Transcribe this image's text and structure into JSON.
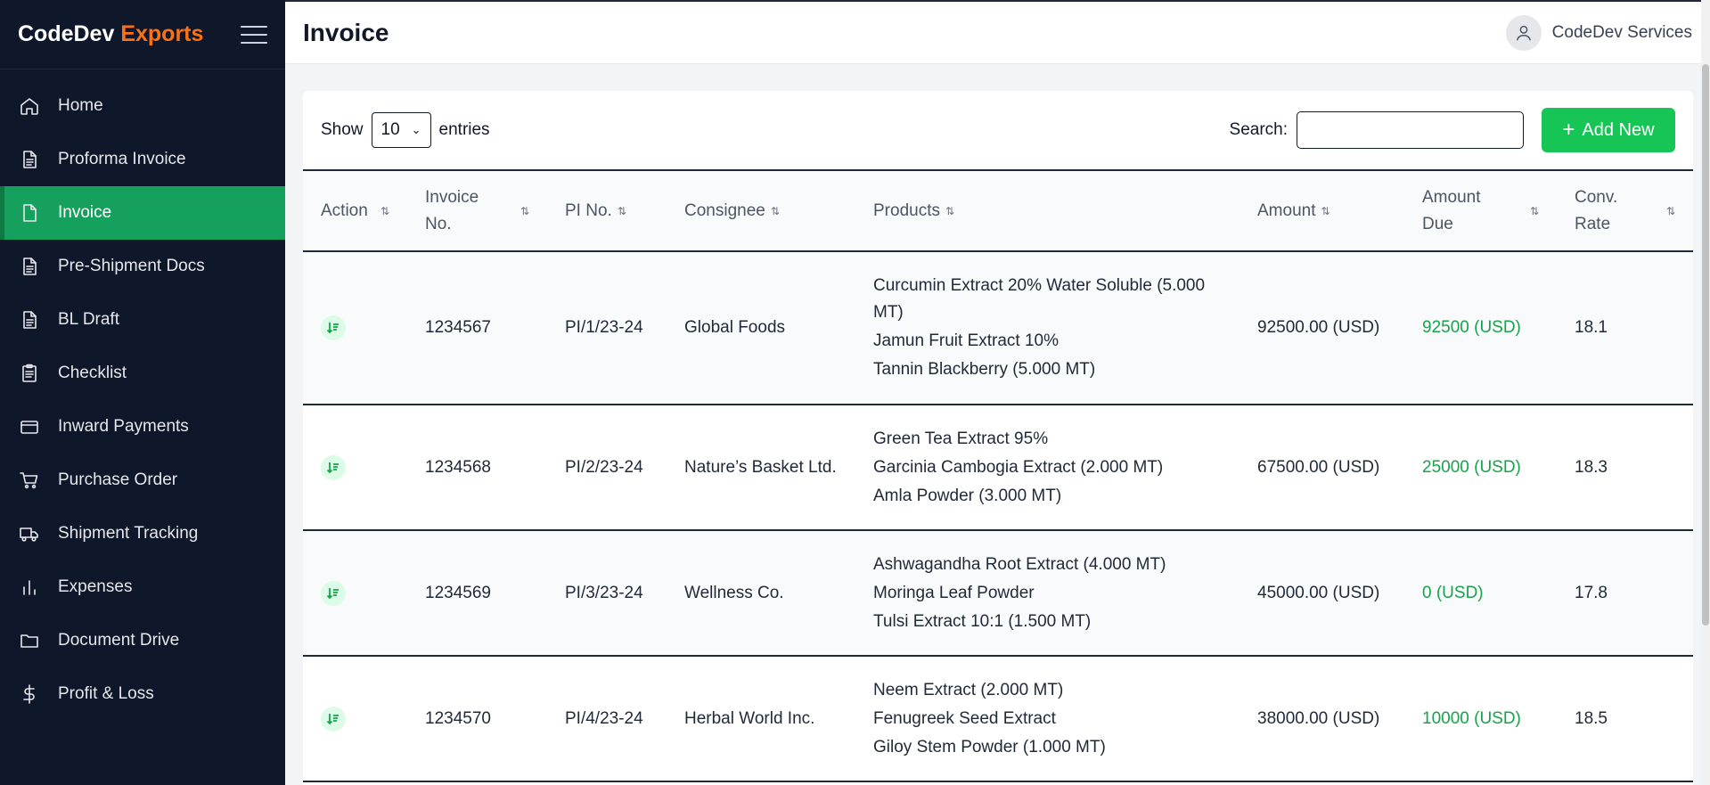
{
  "brand": {
    "name": "CodeDev",
    "accent": "Exports",
    "accent_color": "#f97316"
  },
  "sidebar": {
    "items": [
      {
        "label": "Home",
        "icon": "home-icon"
      },
      {
        "label": "Proforma Invoice",
        "icon": "document-icon"
      },
      {
        "label": "Invoice",
        "icon": "file-icon",
        "active": true
      },
      {
        "label": "Pre-Shipment Docs",
        "icon": "document-icon"
      },
      {
        "label": "BL Draft",
        "icon": "document-icon"
      },
      {
        "label": "Checklist",
        "icon": "clipboard-icon"
      },
      {
        "label": "Inward Payments",
        "icon": "credit-card-icon"
      },
      {
        "label": "Purchase Order",
        "icon": "cart-icon"
      },
      {
        "label": "Shipment Tracking",
        "icon": "truck-icon"
      },
      {
        "label": "Expenses",
        "icon": "bar-chart-icon"
      },
      {
        "label": "Document Drive",
        "icon": "folder-icon"
      },
      {
        "label": "Profit & Loss",
        "icon": "dollar-icon"
      }
    ]
  },
  "header": {
    "title": "Invoice",
    "user": "CodeDev Services"
  },
  "controls": {
    "show_label": "Show",
    "entries_value": "10",
    "entries_label": "entries",
    "search_label": "Search:",
    "search_value": "",
    "add_label": "Add New"
  },
  "table": {
    "columns": [
      "Action",
      "Invoice No.",
      "PI No.",
      "Consignee",
      "Products",
      "Amount",
      "Amount Due",
      "Conv. Rate"
    ],
    "rows": [
      {
        "invoice_no": "1234567",
        "pi_no": "PI/1/23-24",
        "consignee": "Global Foods",
        "products": [
          "Curcumin Extract 20% Water Soluble (5.000 MT)",
          "Jamun Fruit Extract 10%",
          "Tannin Blackberry (5.000 MT)"
        ],
        "amount": "92500.00 (USD)",
        "amount_due": "92500 (USD)",
        "conv_rate": "18.1"
      },
      {
        "invoice_no": "1234568",
        "pi_no": "PI/2/23-24",
        "consignee": "Nature’s Basket Ltd.",
        "products": [
          "Green Tea Extract 95%",
          "Garcinia Cambogia Extract (2.000 MT)",
          "Amla Powder (3.000 MT)"
        ],
        "amount": "67500.00 (USD)",
        "amount_due": "25000 (USD)",
        "conv_rate": "18.3"
      },
      {
        "invoice_no": "1234569",
        "pi_no": "PI/3/23-24",
        "consignee": "Wellness Co.",
        "products": [
          "Ashwagandha Root Extract (4.000 MT)",
          "Moringa Leaf Powder",
          "Tulsi Extract 10:1 (1.500 MT)"
        ],
        "amount": "45000.00 (USD)",
        "amount_due": "0 (USD)",
        "conv_rate": "17.8"
      },
      {
        "invoice_no": "1234570",
        "pi_no": "PI/4/23-24",
        "consignee": "Herbal World Inc.",
        "products": [
          "Neem Extract (2.000 MT)",
          "Fenugreek Seed Extract",
          "Giloy Stem Powder (1.000 MT)"
        ],
        "amount": "38000.00 (USD)",
        "amount_due": "10000 (USD)",
        "conv_rate": "18.5"
      }
    ]
  },
  "colors": {
    "sidebar_bg": "#0f172a",
    "active_item": "#16a05d",
    "add_button": "#16c556",
    "due_text": "#16a34a"
  }
}
